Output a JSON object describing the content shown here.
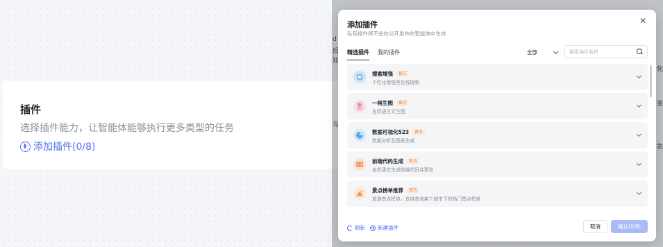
{
  "background_card": {
    "title": "插件",
    "description": "选择插件能力，让智能体能够执行更多类型的任务",
    "add_label": "添加插件(0/8)"
  },
  "peeks": [
    "d",
    "后",
    "知",
    "化",
    "与",
    "变",
    "急"
  ],
  "modal": {
    "title": "添加插件",
    "subtitle": "私有插件将不会在公开发布的智能体中生效",
    "tabs": [
      {
        "label": "精选插件",
        "active": true
      },
      {
        "label": "我的插件",
        "active": false
      }
    ],
    "filter_value": "全部",
    "search_placeholder": "搜索插件名称",
    "badge_label": "官方",
    "plugins": [
      {
        "name": "搜索增强",
        "badge": "官方",
        "desc": "个性化增强型在线搜索",
        "icon": "search-enhance-icon",
        "color": "#cfe3f6"
      },
      {
        "name": "一格生图",
        "badge": "官方",
        "desc": "自然语言文生图",
        "icon": "image-gen-icon",
        "color": "#f7dce4"
      },
      {
        "name": "数据可视化523",
        "badge": "官方",
        "desc": "数据分析及图表生成",
        "icon": "data-viz-icon",
        "color": "#d4ebf7"
      },
      {
        "name": "前端代码生成",
        "badge": "官方",
        "desc": "自然语言生成前端代码并预览",
        "icon": "frontend-code-icon",
        "color": "#fbe3d2"
      },
      {
        "name": "景点榜单推荐",
        "badge": "官方",
        "desc": "旅游景点榜单，支持查询某个城市下的热门景点榜单",
        "icon": "scenic-ranking-icon",
        "color": "#fde8d9"
      }
    ],
    "refresh_label": "刷新",
    "new_plugin_label": "新建插件",
    "cancel_label": "取消",
    "confirm_label": "确认(0/8)"
  }
}
